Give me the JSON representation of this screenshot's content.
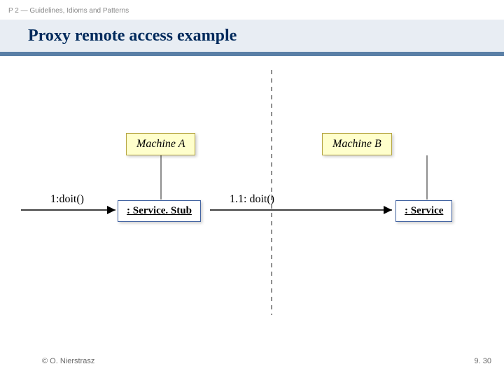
{
  "header": {
    "breadcrumb": "P 2 — Guidelines, Idioms and Patterns",
    "title": "Proxy remote access example"
  },
  "diagram": {
    "machines": [
      {
        "id": "machine-a",
        "label": "Machine A"
      },
      {
        "id": "machine-b",
        "label": "Machine B"
      }
    ],
    "objects": [
      {
        "id": "service-stub",
        "label": ": Service. Stub"
      },
      {
        "id": "service",
        "label": ": Service"
      }
    ],
    "calls": [
      {
        "id": "call-1",
        "label": "1:doit()"
      },
      {
        "id": "call-1-1",
        "label": "1.1: doit()"
      }
    ]
  },
  "footer": {
    "copyright": "© O. Nierstrasz",
    "page": "9. 30"
  },
  "colors": {
    "banner_bg": "#e8edf3",
    "accent": "#5a7fa6",
    "title": "#002a5c",
    "box_fill": "#ffffcc",
    "box_border": "#b5a642",
    "svc_border": "#4263a1"
  }
}
